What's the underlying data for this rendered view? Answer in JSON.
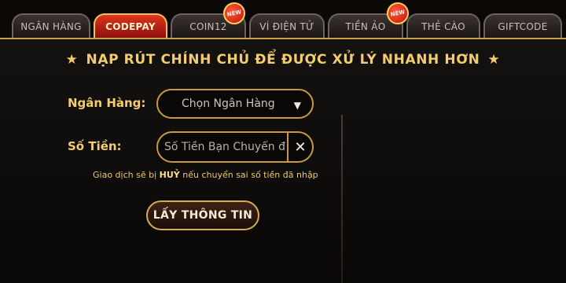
{
  "tabs": [
    {
      "label": "NGÂN HÀNG"
    },
    {
      "label": "CODEPAY",
      "active": true
    },
    {
      "label": "COIN12",
      "badge": "NEW"
    },
    {
      "label": "VÍ ĐIỆN TỬ"
    },
    {
      "label": "TIỀN ẢO",
      "badge": "NEW"
    },
    {
      "label": "THẺ CÀO"
    },
    {
      "label": "GIFTCODE"
    }
  ],
  "heading": {
    "star_icon": "★",
    "text": "NẠP RÚT CHÍNH CHỦ ĐỂ ĐƯỢC XỬ LÝ NHANH HƠN"
  },
  "form": {
    "bank_label": "Ngân Hàng:",
    "bank_select": {
      "value": "Chọn Ngân Hàng",
      "icon": "triangle-down-icon"
    },
    "amount_label": "Số Tiền:",
    "amount_input": {
      "value": "",
      "placeholder": "Số Tiền Bạn Chuyển đ",
      "clear_icon": "close-icon"
    },
    "note_prefix": "Giao dịch sẽ bị ",
    "note_emphasis": "HUỶ",
    "note_suffix": " nếu chuyển sai số tiền đã nhập",
    "submit_label": "LẤY THÔNG TIN"
  },
  "colors": {
    "accent_gold": "#f3cd6d",
    "active_tab_red": "#c42015",
    "border_gold": "#c79a40"
  }
}
